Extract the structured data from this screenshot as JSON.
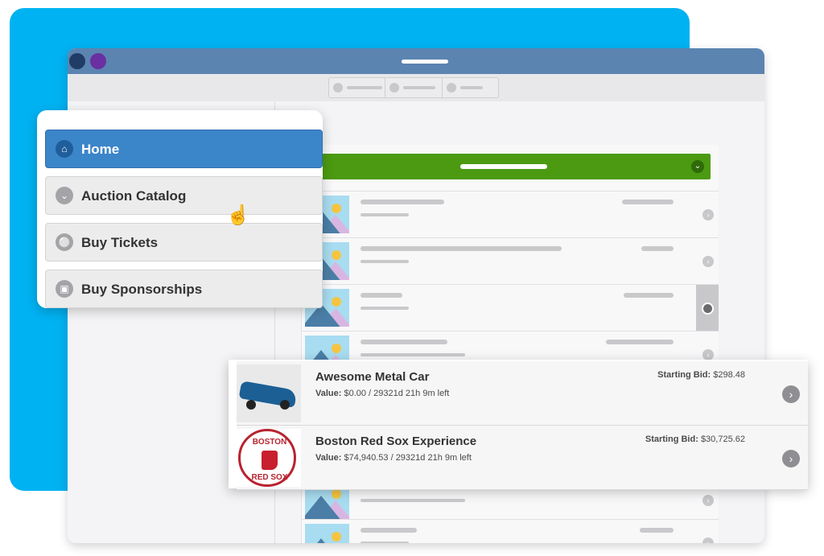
{
  "nav": {
    "items": [
      {
        "label": "Home",
        "icon": "home-icon",
        "active": true
      },
      {
        "label": "Auction Catalog",
        "icon": "chevron-down-icon",
        "active": false
      },
      {
        "label": "Buy Tickets",
        "icon": "tag-icon",
        "active": false
      },
      {
        "label": "Buy Sponsorships",
        "icon": "bag-icon",
        "active": false
      }
    ]
  },
  "items": [
    {
      "title": "Awesome Metal Car",
      "value_label": "Value:",
      "value_text": "$0.00 / 29321d 21h 9m left",
      "bid_label": "Starting Bid:",
      "bid_value": "$298.48"
    },
    {
      "title": "Boston Red Sox Experience",
      "value_label": "Value:",
      "value_text": "$74,940.53 / 29321d 21h 9m left",
      "bid_label": "Starting Bid:",
      "bid_value": "$30,725.62",
      "logo_text_top": "BOSTON",
      "logo_text_bottom": "RED SOX"
    }
  ],
  "colors": {
    "background_accent": "#00b2f2",
    "titlebar": "#5b84b1",
    "active_nav": "#3b85c9",
    "header_bar": "#4b9a12"
  }
}
